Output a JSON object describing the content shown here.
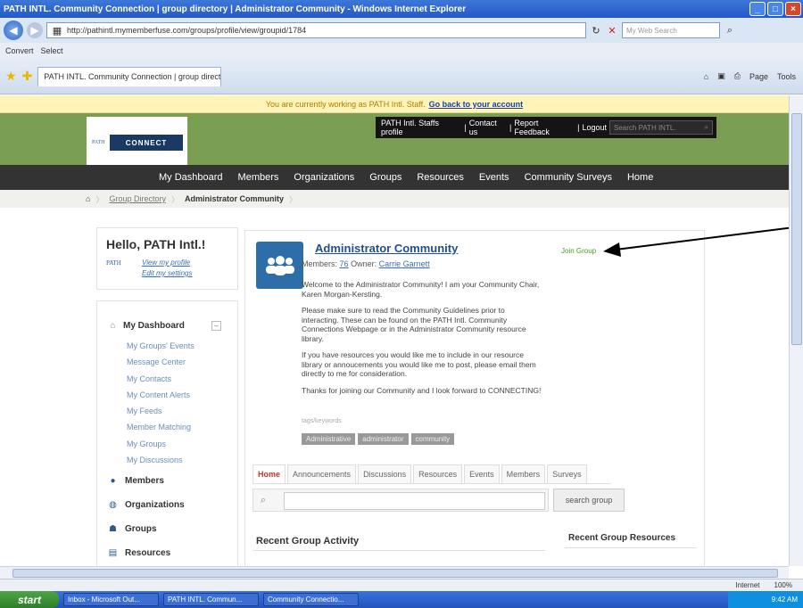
{
  "window": {
    "title": "PATH INTL. Community Connection | group directory | Administrator Community - Windows Internet Explorer"
  },
  "browser": {
    "url": "http://pathintl.mymemberfuse.com/groups/profile/view/groupid/1784",
    "search_placeholder": "My Web Search",
    "links": [
      "Convert",
      "Select"
    ],
    "tab_label": "PATH INTL. Community Connection | group directory |...",
    "tools": [
      "Page",
      "Tools"
    ],
    "status": [
      "Internet",
      "100%"
    ]
  },
  "staff_bar": {
    "text": "You are currently working as PATH Intl. Staff.",
    "link": "Go back to your account"
  },
  "header": {
    "top_links": [
      "PATH Intl. Staffs profile",
      "Contact us",
      "Report Feedback",
      "Logout"
    ],
    "search_placeholder": "Search PATH INTL.",
    "logo_small": "PATH",
    "logo_brand": "CONNECT"
  },
  "nav": [
    "My Dashboard",
    "Members",
    "Organizations",
    "Groups",
    "Resources",
    "Events",
    "Community Surveys",
    "Home"
  ],
  "breadcrumb": {
    "link": "Group Directory",
    "current": "Administrator Community"
  },
  "hello": {
    "greeting": "Hello, PATH Intl.!",
    "pic_label": "PATH",
    "links": [
      "View my profile",
      "Edit my settings"
    ]
  },
  "sidebar": {
    "dashboard": "My Dashboard",
    "collapse": "–",
    "sub_items": [
      "My Groups' Events",
      "Message Center",
      "My Contacts",
      "My Content Alerts",
      "My Feeds",
      "Member Matching",
      "My Groups",
      "My Discussions"
    ],
    "sections": [
      "Members",
      "Organizations",
      "Groups",
      "Resources"
    ]
  },
  "group": {
    "title": "Administrator Community",
    "members_label": "Members:",
    "members_count": "76",
    "owner_label": "Owner:",
    "owner_name": "Carrie Garnett",
    "join": "Join Group",
    "description": [
      "Welcome to the Administrator Community! I am your Community Chair, Karen Morgan-Kersting.",
      "Please make sure to read the Community Guidelines prior to interacting. These can be found on the PATH Intl. Community Connections Webpage or in the Administrator Community resource library.",
      "If you have resources you would like me to include in our resource library or annoucements you would like me to post, please email them directly to me for consideration.",
      "Thanks for joining our Community and I look forward to CONNECTING!"
    ],
    "tags_label": "tags/keywords",
    "tags": [
      "Administrative",
      "administrator",
      "community"
    ],
    "tabs": [
      "Home",
      "Announcements",
      "Discussions",
      "Resources",
      "Events",
      "Members",
      "Surveys"
    ],
    "search_button": "search group",
    "recent_activity": "Recent Group Activity",
    "recent_resources": "Recent Group Resources"
  },
  "taskbar": {
    "start": "start",
    "tasks": [
      "Inbox - Microsoft Out...",
      "PATH INTL. Commun...",
      "Community Connectio..."
    ],
    "clock": "9:42 AM"
  }
}
